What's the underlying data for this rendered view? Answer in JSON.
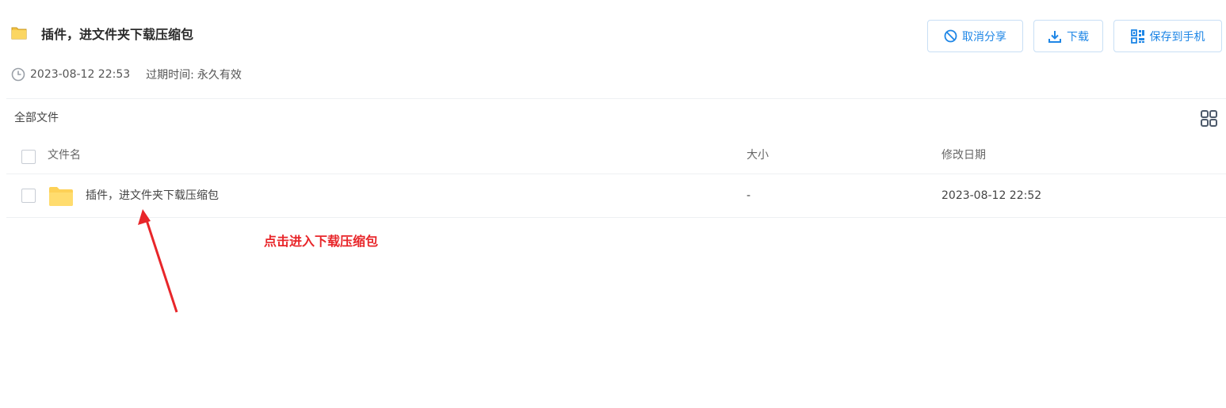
{
  "share": {
    "title": "插件，进文件夹下载压缩包",
    "created_at": "2023-08-12 22:53",
    "expire_label": "过期时间:",
    "expire_value": "永久有效"
  },
  "toolbar": {
    "cancel_share_label": "取消分享",
    "download_label": "下载",
    "save_to_phone_label": "保存到手机"
  },
  "breadcrumb": {
    "label": "全部文件"
  },
  "table": {
    "columns": {
      "name": "文件名",
      "size": "大小",
      "modified": "修改日期"
    },
    "rows": [
      {
        "name": "插件，进文件夹下载压缩包",
        "size": "-",
        "modified": "2023-08-12 22:52"
      }
    ]
  },
  "annotation": {
    "text": "点击进入下载压缩包"
  },
  "colors": {
    "accent": "#1e86e6",
    "folder": "#fdd156",
    "annotation": "#e8262a"
  },
  "icons": {
    "folder": "folder-icon",
    "clock": "clock-icon",
    "cancel": "no-entry-icon",
    "download": "download-icon",
    "qr": "qr-code-icon",
    "grid": "grid-view-icon"
  }
}
